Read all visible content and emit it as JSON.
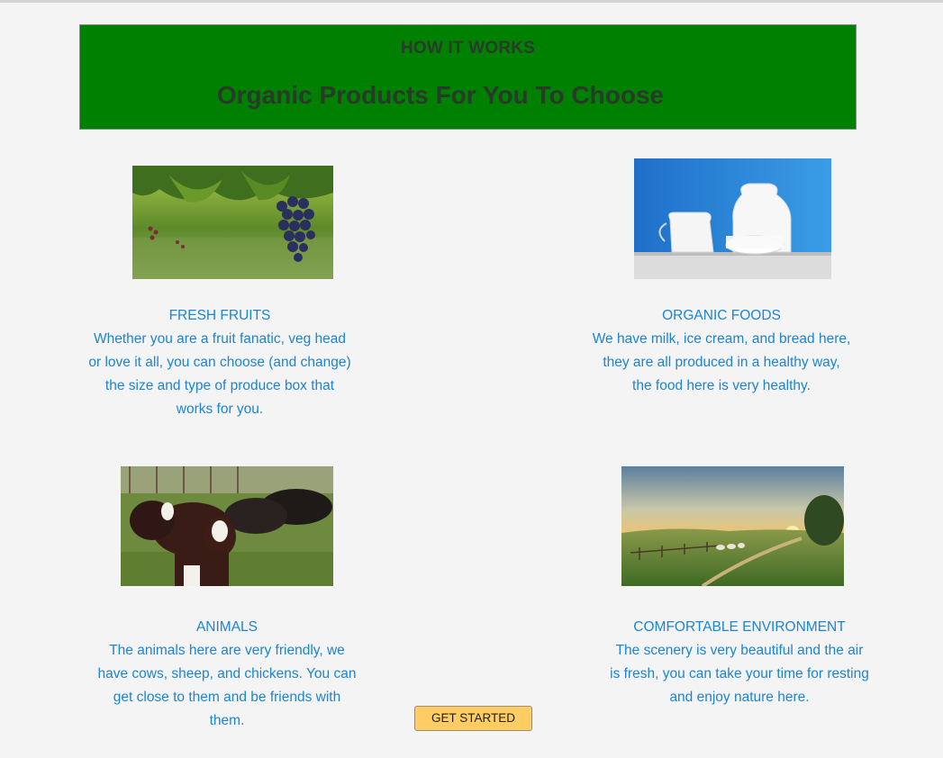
{
  "header": {
    "kicker": "HOW IT WORKS",
    "title": "Organic Products For You To Choose"
  },
  "cards": [
    {
      "image": "grapes-vineyard-photo",
      "title": "FRESH FRUITS",
      "description": "Whether you are a fruit fanatic, veg head\nor love it all, you can choose (and change)\nthe size and type of produce box that\nworks for you."
    },
    {
      "image": "milk-jugs-photo",
      "title": "ORGANIC FOODS",
      "description": "We have milk, ice cream, and bread here,\nthey are all produced in a healthy way,\nthe food here is very healthy."
    },
    {
      "image": "cows-in-field-photo",
      "title": "ANIMALS",
      "description": "The animals here are very friendly, we\nhave cows, sheep, and chickens.  You can\nget close to them and be friends with\nthem."
    },
    {
      "image": "countryside-sunset-photo",
      "title": "COMFORTABLE ENVIRONMENT",
      "description": "The scenery is very beautiful and the air\nis fresh, you can take your time for resting\nand enjoy nature here."
    }
  ],
  "cta": {
    "label": "GET STARTED"
  },
  "colors": {
    "banner": "#008000",
    "text_accent": "#1b84d6",
    "button": "#ffcd64",
    "page_background": "#f4f4f4"
  }
}
